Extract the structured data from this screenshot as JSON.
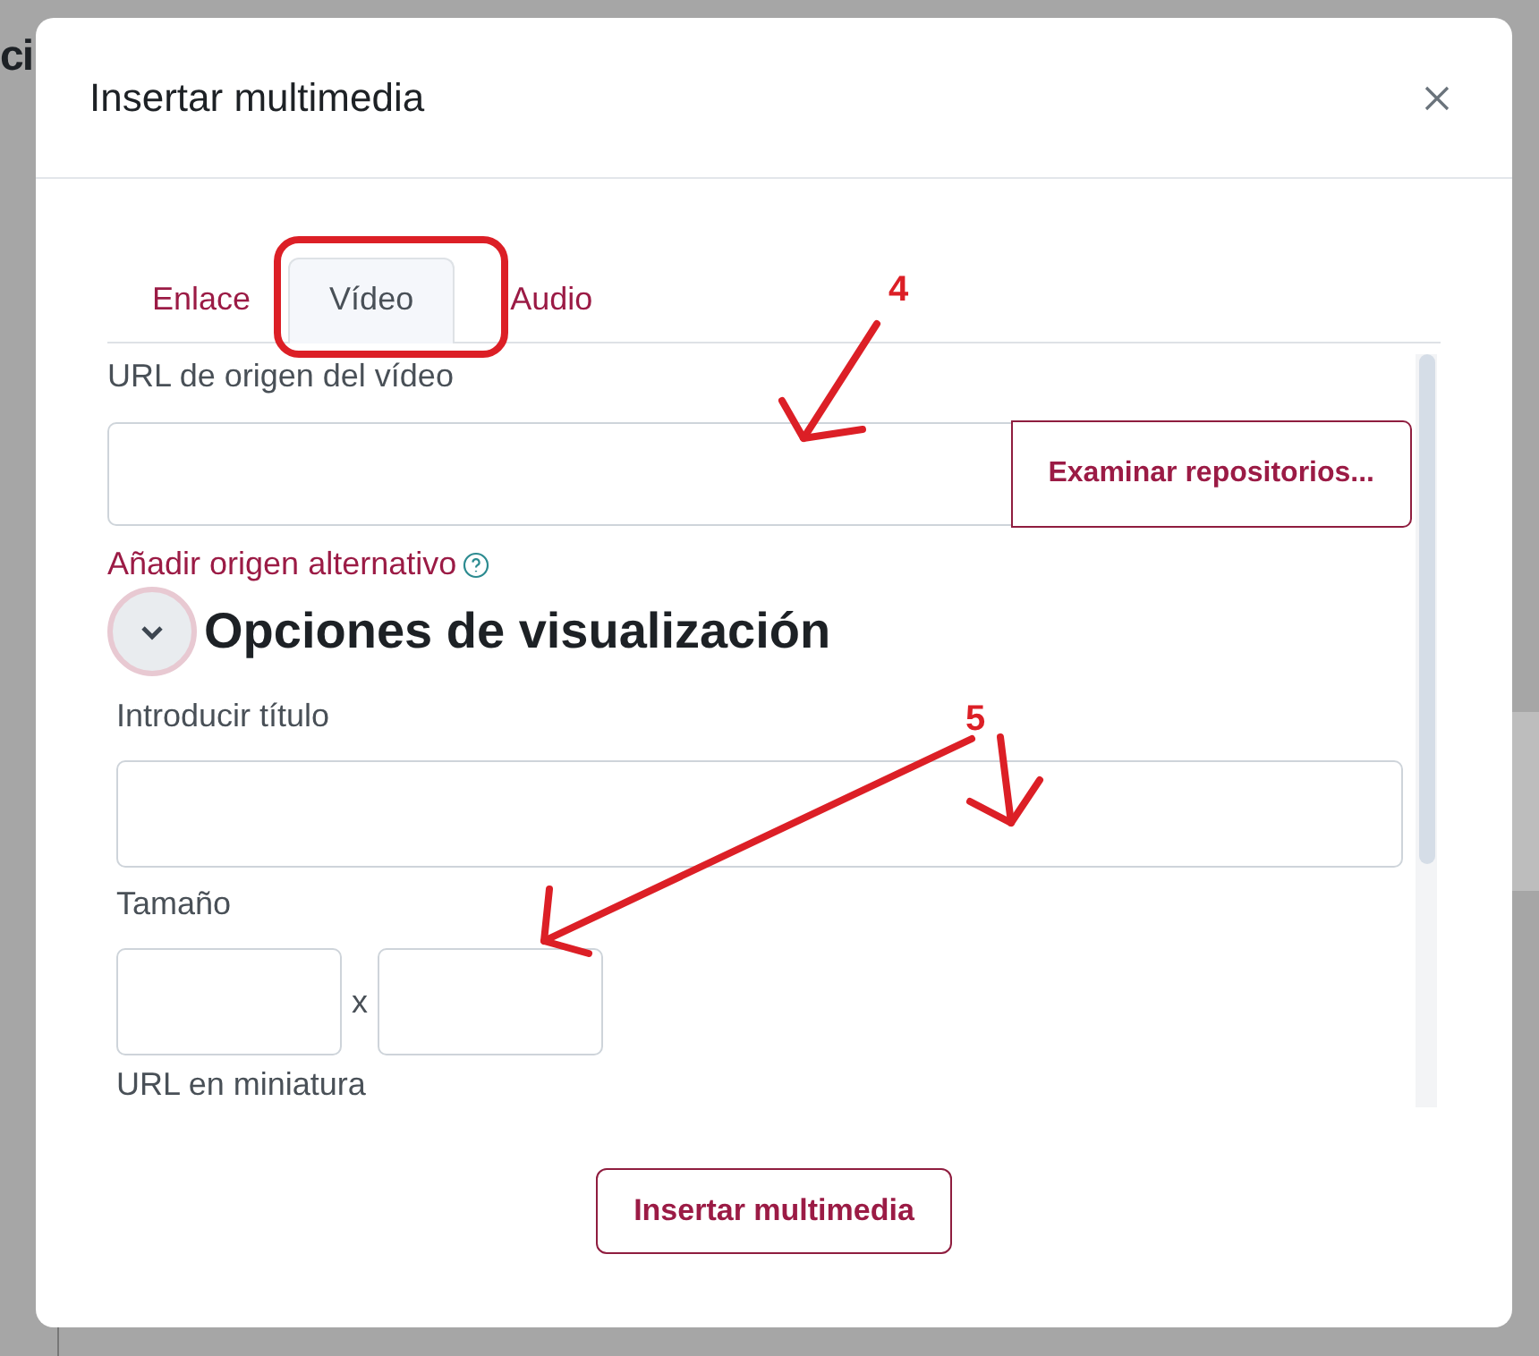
{
  "background": {
    "heading_fragment": "ci"
  },
  "dialog": {
    "title": "Insertar multimedia",
    "tabs": [
      {
        "label": "Enlace",
        "selected": false
      },
      {
        "label": "Vídeo",
        "selected": true
      },
      {
        "label": "Audio",
        "selected": false
      }
    ],
    "video_url": {
      "label": "URL de origen del vídeo"
    },
    "browse_button": "Examinar repositorios...",
    "alternative_source_link": "Añadir origen alternativo",
    "display_options": {
      "heading": "Opciones de visualización",
      "expanded": true
    },
    "title_field": {
      "label": "Introducir título"
    },
    "size": {
      "label": "Tamaño",
      "separator": "x"
    },
    "thumbnail_url": {
      "label": "URL en miniatura"
    },
    "submit_button": "Insertar multimedia"
  },
  "annotations": {
    "highlight_selected_tab": true,
    "callouts": [
      {
        "label": "4"
      },
      {
        "label": "5"
      }
    ]
  }
}
